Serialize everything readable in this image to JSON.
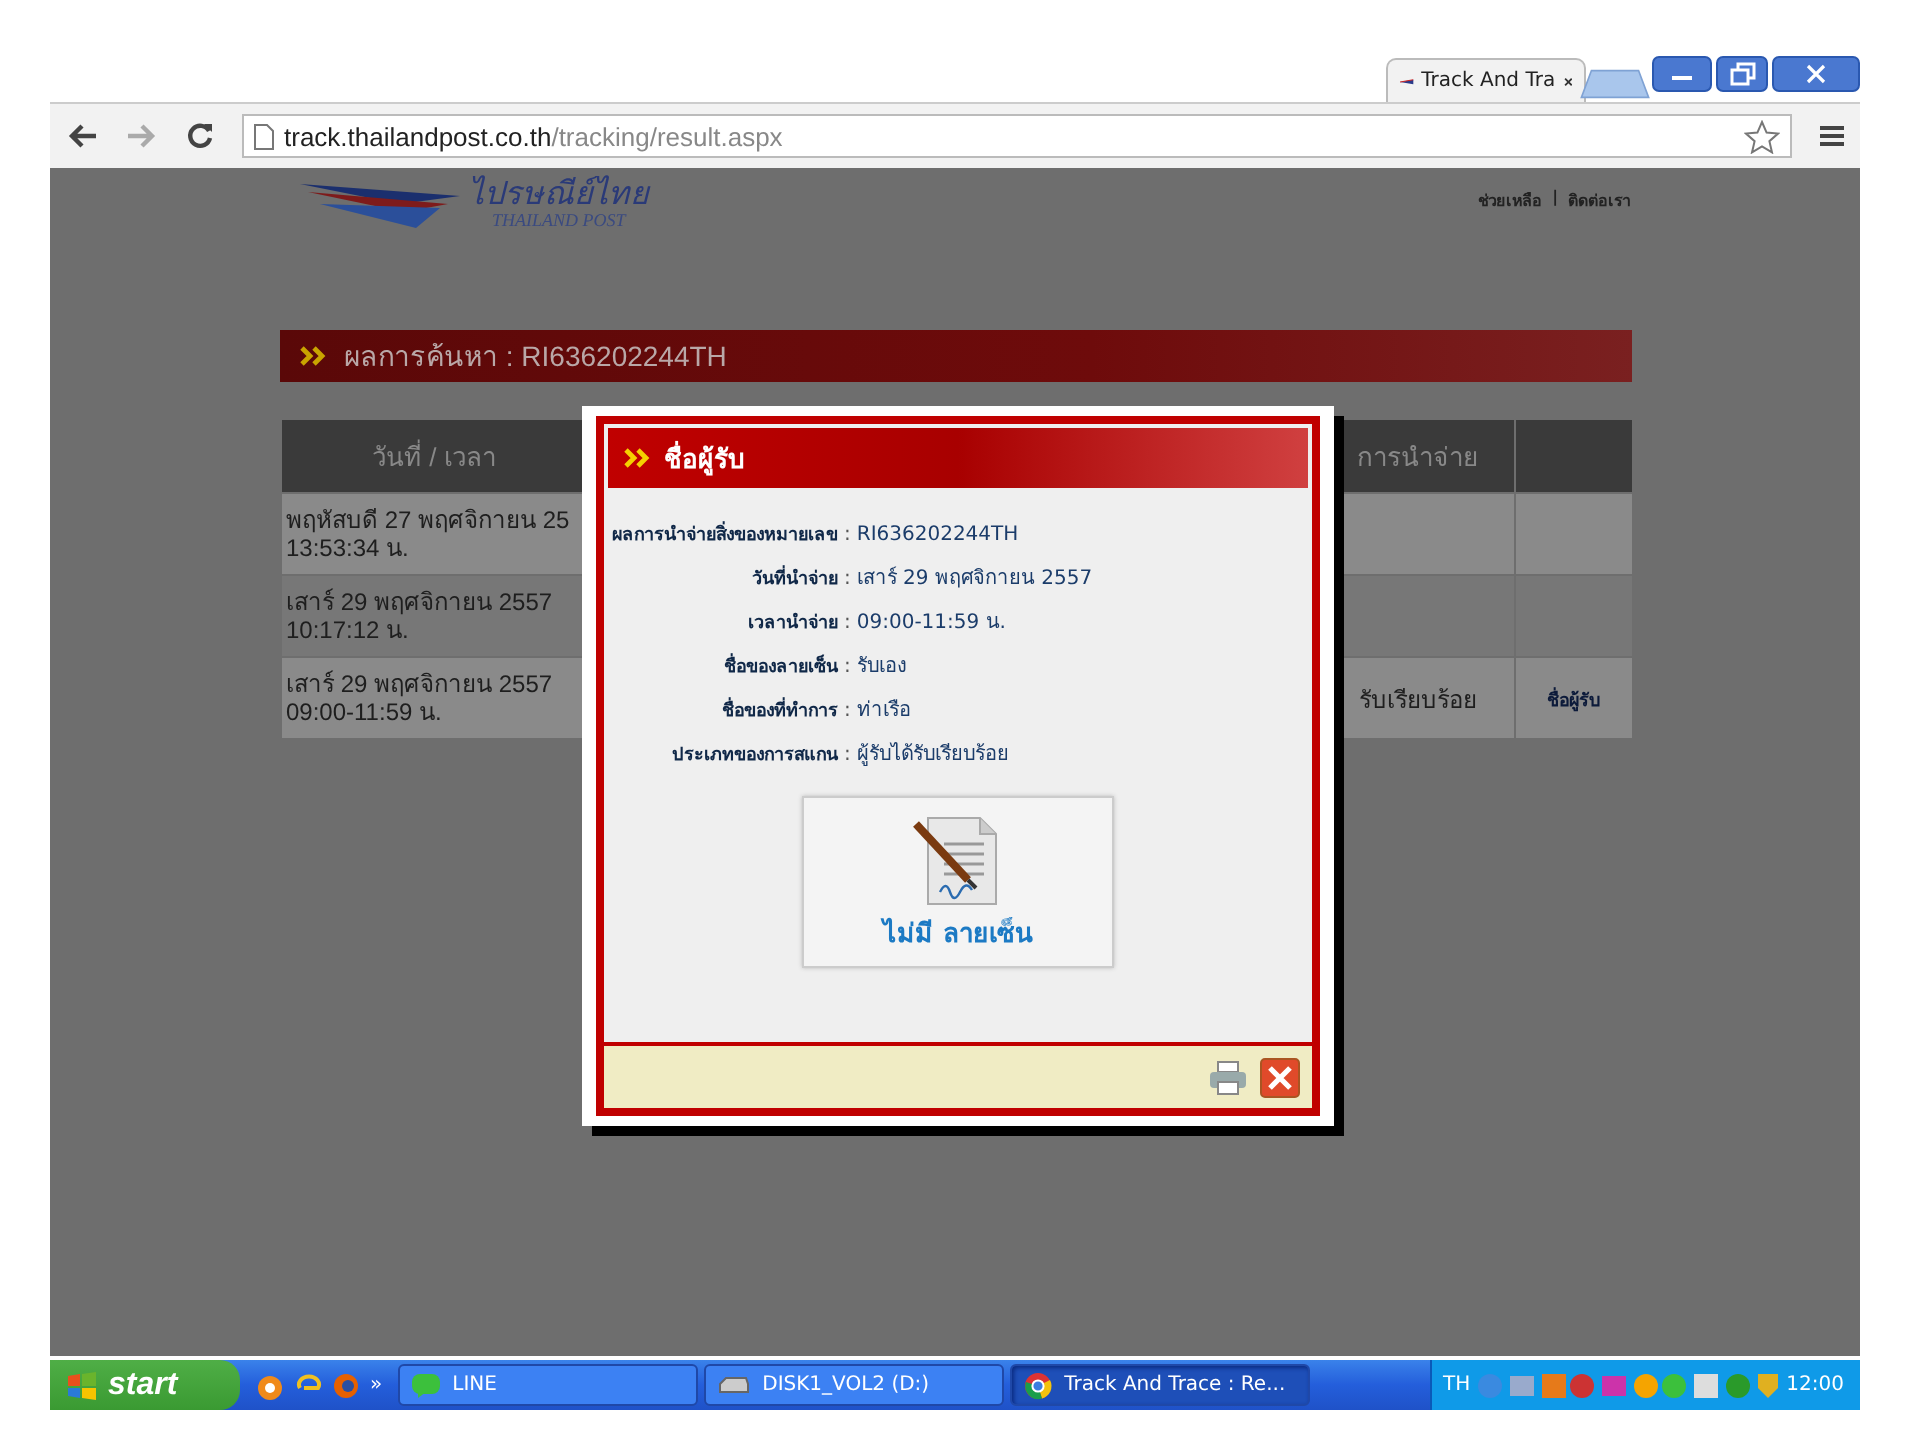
{
  "browser": {
    "tab_title": "Track And Tra",
    "url_host": "track.thailandpost.co.th",
    "url_path": "/tracking/result.aspx"
  },
  "site": {
    "logo_thai": "ไปรษณีย์ไทย",
    "logo_english": "THAILAND POST",
    "links": [
      "ช่วยเหลือ",
      "ติดต่อเรา"
    ],
    "link_separator": "|"
  },
  "results": {
    "title": "ผลการค้นหา : RI636202244TH",
    "columns": [
      {
        "label": "วันที่ / เวลา"
      },
      {
        "label": "การนำจ่าย"
      }
    ],
    "rows": [
      {
        "date": "พฤหัสบดี 27 พฤศจิกายน 25",
        "time": "13:53:34 น."
      },
      {
        "date": "เสาร์ 29 พฤศจิกายน 2557",
        "time": "10:17:12 น."
      },
      {
        "date": "เสาร์ 29 พฤศจิกายน 2557",
        "time": "09:00-11:59 น.",
        "status": "รับเรียบร้อย",
        "action": "ชื่อผู้รับ"
      }
    ]
  },
  "modal": {
    "title": "ชื่อผู้รับ",
    "fields": [
      {
        "label": "ผลการนำจ่ายสิ่งของหมายเลข",
        "value": "RI636202244TH"
      },
      {
        "label": "วันที่นำจ่าย",
        "value": "เสาร์ 29 พฤศจิกายน 2557"
      },
      {
        "label": "เวลานำจ่าย",
        "value": "09:00-11:59 น."
      },
      {
        "label": "ชื่อของลายเซ็น",
        "value": "รับเอง"
      },
      {
        "label": "ชื่อของที่ทำการ",
        "value": "ท่าเรือ"
      },
      {
        "label": "ประเภทของการสแกน",
        "value": "ผู้รับได้รับเรียบร้อย"
      }
    ],
    "separator": ":",
    "signature_caption": "ไม่มี ลายเซ็น"
  },
  "taskbar": {
    "start": "start",
    "more": "»",
    "tasks": [
      {
        "label": "LINE",
        "kind": "chat",
        "selected": false
      },
      {
        "label": "DISK1_VOL2 (D:)",
        "kind": "drive",
        "selected": false
      },
      {
        "label": "Track And Trace : Re...",
        "kind": "browser",
        "selected": true
      }
    ],
    "language": "TH",
    "clock": "12:00"
  }
}
